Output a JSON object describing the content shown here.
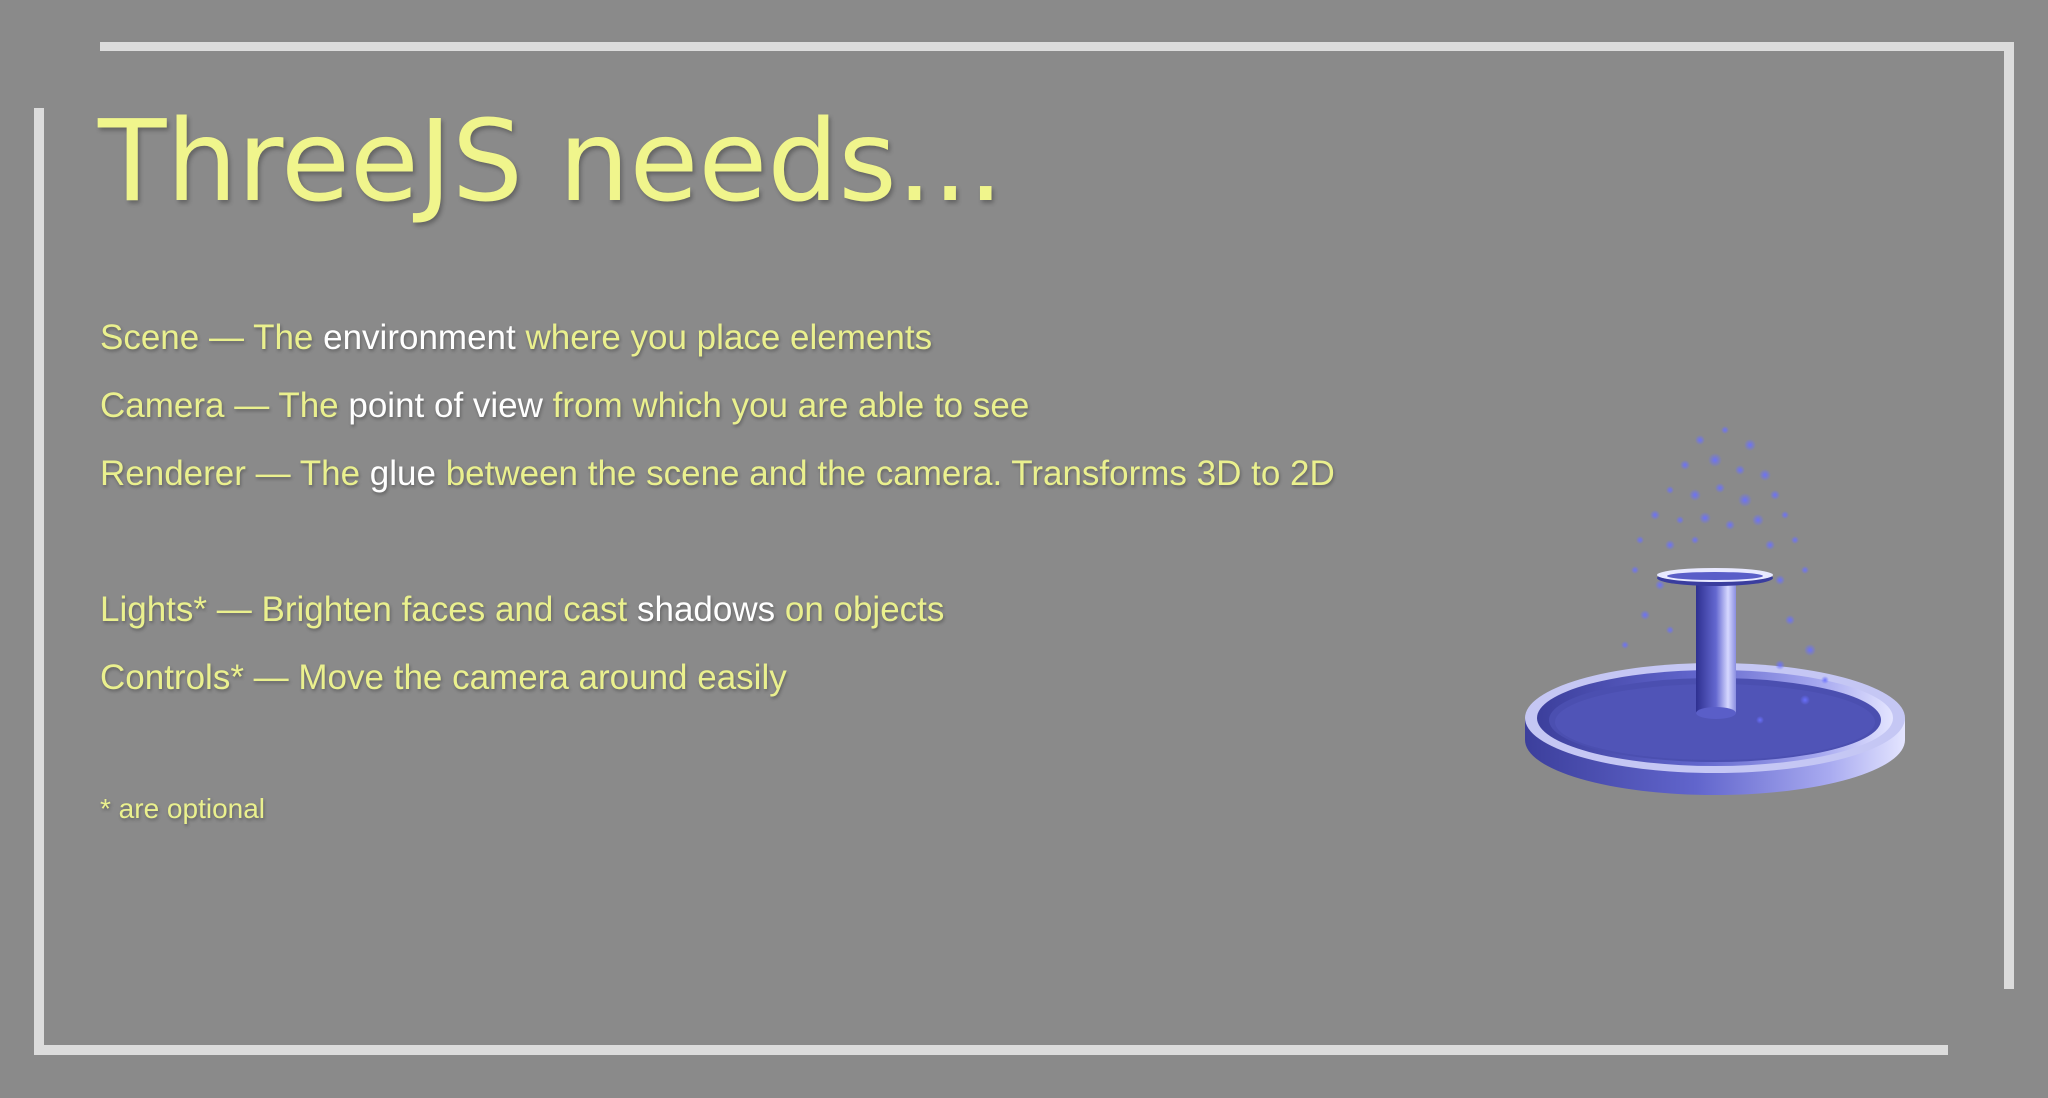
{
  "slide": {
    "title": "ThreeJS needs...",
    "items": [
      {
        "term": "Scene",
        "sep": " — ",
        "pre": "The ",
        "emphasis": "environment",
        "post": " where you place elements"
      },
      {
        "term": "Camera",
        "sep": " — ",
        "pre": "The ",
        "emphasis": "point of view",
        "post": " from which you are able to see"
      },
      {
        "term": "Renderer",
        "sep": " — ",
        "pre": "The ",
        "emphasis": "glue",
        "post": " between the scene and the camera. Transforms 3D to 2D"
      },
      {
        "term": "Lights*",
        "sep": " — ",
        "pre": "Brighten faces and cast ",
        "emphasis": "shadows",
        "post": " on objects"
      },
      {
        "term": "Controls*",
        "sep": " — ",
        "pre": "Move the camera around easily",
        "emphasis": "",
        "post": ""
      }
    ],
    "footnote": "* are optional"
  },
  "colors": {
    "background": "#8a8a8a",
    "frame": "#dcdcdc",
    "accent_text": "#eaf08e",
    "highlight_text": "#ffffff",
    "fountain": "#5a5ec8"
  },
  "image": {
    "icon": "fountain-particles-icon"
  }
}
